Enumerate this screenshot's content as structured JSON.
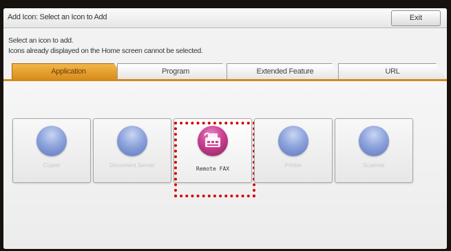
{
  "window": {
    "title": "Add Icon: Select an Icon to Add",
    "exit_label": "Exit"
  },
  "instructions": {
    "line1": "Select an icon to add.",
    "line2": "Icons already displayed on the Home screen cannot be selected."
  },
  "tabs": [
    {
      "label": "Application",
      "active": true
    },
    {
      "label": "Program",
      "active": false
    },
    {
      "label": "Extended Feature",
      "active": false
    },
    {
      "label": "URL",
      "active": false
    }
  ],
  "icons": [
    {
      "label": "Copier",
      "enabled": false,
      "icon": "copier-orb-icon"
    },
    {
      "label": "Document Server",
      "enabled": false,
      "icon": "document-server-orb-icon"
    },
    {
      "label": "Remote FAX",
      "enabled": true,
      "selected": true,
      "icon": "fax-icon"
    },
    {
      "label": "Printer",
      "enabled": false,
      "icon": "printer-orb-icon"
    },
    {
      "label": "Scanner",
      "enabled": false,
      "icon": "scanner-orb-icon"
    }
  ],
  "colors": {
    "active_tab": "#e3a032",
    "selection_outline": "#d40000",
    "fax_icon": "#c9408f",
    "disabled_orb": "#8ea4dc"
  }
}
